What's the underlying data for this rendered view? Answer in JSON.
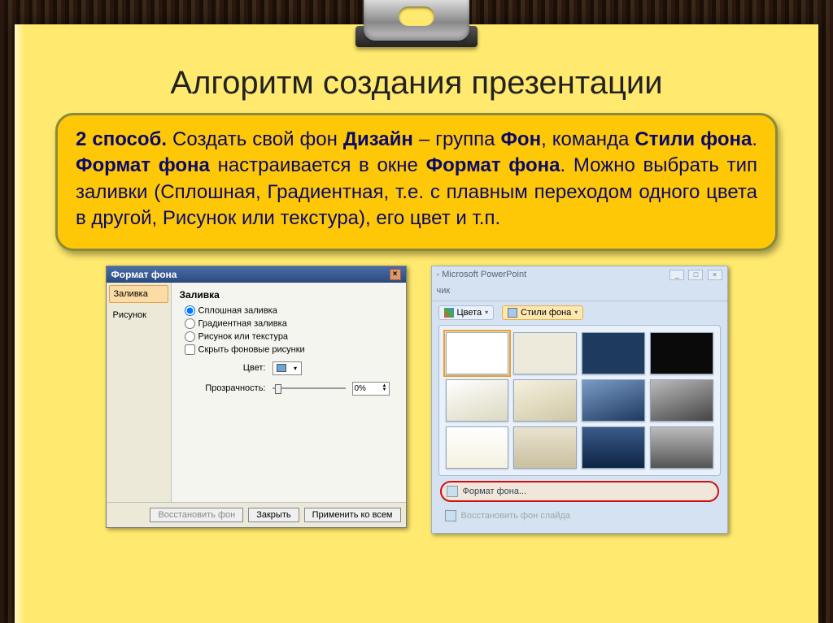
{
  "slide": {
    "title": "Алгоритм создания презентации",
    "body_html": "<b>2 способ.</b> Создать свой фон <b>Дизайн</b> – группа <b>Фон</b>, команда <b>Стили фона</b>. <b>Формат фона</b> настраивается в окне <b>Формат фона</b>. Можно выбрать тип заливки (Сплошная, Градиентная, т.е. с плавным переходом одного цвета в другой, Рисунок или текстура), его цвет и т.п."
  },
  "dlg1": {
    "title": "Формат фона",
    "side": {
      "fill": "Заливка",
      "picture": "Рисунок"
    },
    "heading": "Заливка",
    "opt_solid": "Сплошная заливка",
    "opt_gradient": "Градиентная заливка",
    "opt_picture": "Рисунок или текстура",
    "opt_hide": "Скрыть фоновые рисунки",
    "color_label": "Цвет:",
    "transp_label": "Прозрачность:",
    "transp_value": "0%",
    "btn_reset": "Восстановить фон",
    "btn_close": "Закрыть",
    "btn_applyall": "Применить ко всем"
  },
  "ppt": {
    "app_title": "- Microsoft PowerPoint",
    "rib_tab": "чик",
    "colors": "Цвета",
    "styles": "Стили фона",
    "format_bg": "Формат фона...",
    "reset_bg": "Восстановить фон слайда",
    "thumbs": [
      "#ffffff",
      "#eeeadb",
      "#1f3a5f",
      "#0a0a0a",
      "linear-gradient(160deg,#fff,#dcd8c0)",
      "linear-gradient(160deg,#f5f1e0,#cfc7a5)",
      "linear-gradient(160deg,#7a9bc7,#1f3a5f)",
      "linear-gradient(160deg,#bbb,#444)",
      "linear-gradient(#fff,#f5f1e0)",
      "linear-gradient(#e9e3cf,#c9c0a0)",
      "linear-gradient(#3a5a88,#0e2545)",
      "linear-gradient(#bbb,#555)"
    ]
  }
}
